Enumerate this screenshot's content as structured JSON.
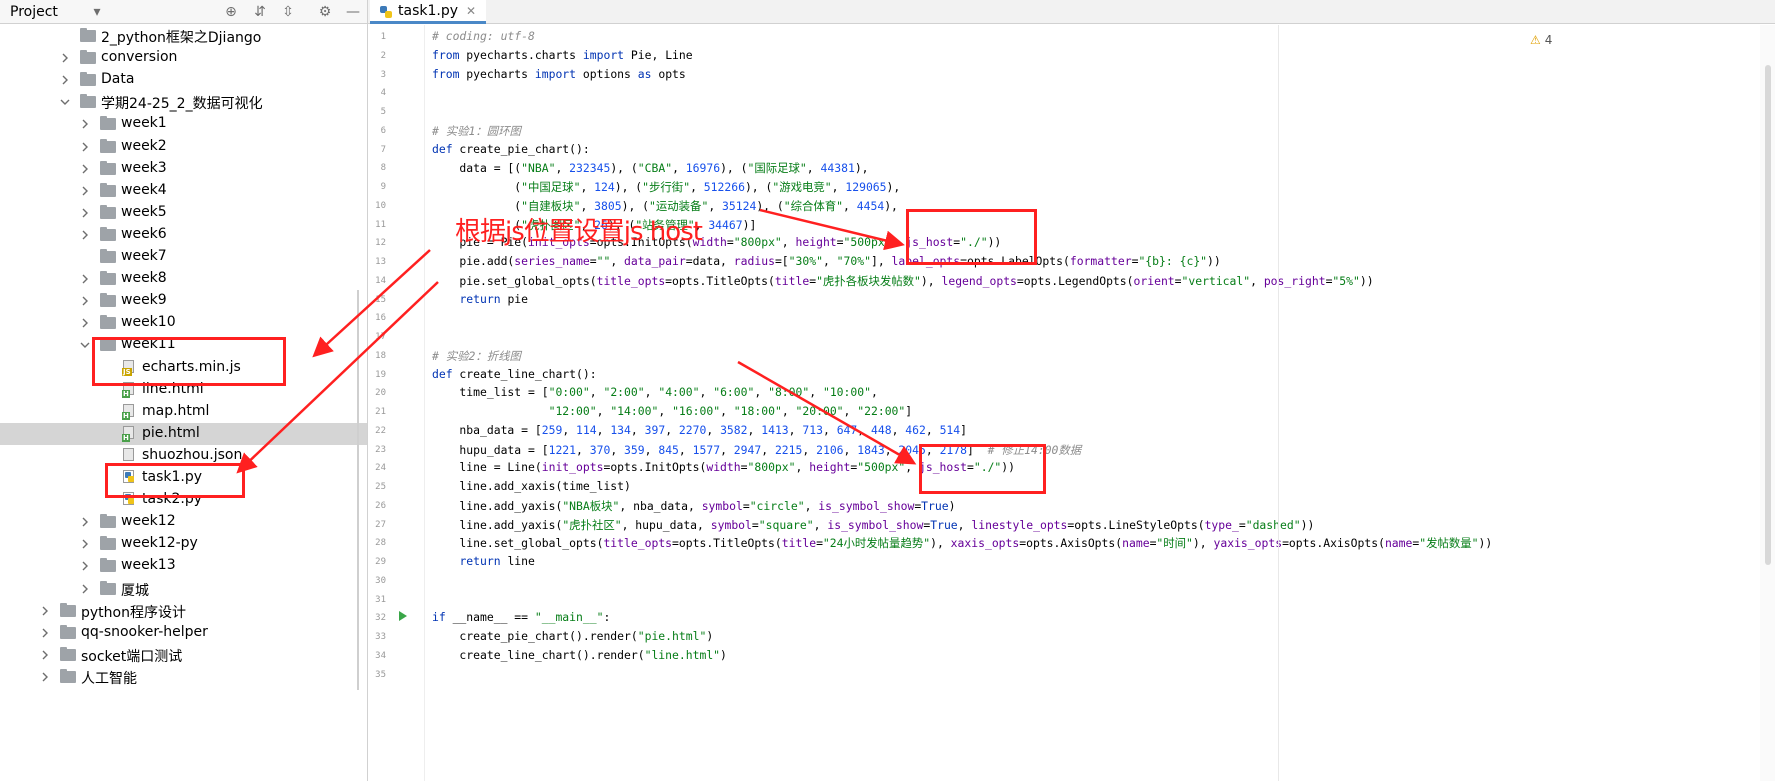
{
  "project_panel": {
    "title": "Project",
    "tree": [
      {
        "label": "2_python框架之Djiango",
        "indent": 1,
        "type": "folder",
        "expanded": null
      },
      {
        "label": "conversion",
        "indent": 1,
        "type": "folder",
        "expanded": false
      },
      {
        "label": "Data",
        "indent": 1,
        "type": "folder",
        "expanded": false
      },
      {
        "label": "学期24-25_2_数据可视化",
        "indent": 1,
        "type": "folder",
        "expanded": true
      },
      {
        "label": "week1",
        "indent": 2,
        "type": "folder",
        "expanded": false
      },
      {
        "label": "week2",
        "indent": 2,
        "type": "folder",
        "expanded": false
      },
      {
        "label": "week3",
        "indent": 2,
        "type": "folder",
        "expanded": false
      },
      {
        "label": "week4",
        "indent": 2,
        "type": "folder",
        "expanded": false
      },
      {
        "label": "week5",
        "indent": 2,
        "type": "folder",
        "expanded": false
      },
      {
        "label": "week6",
        "indent": 2,
        "type": "folder",
        "expanded": false
      },
      {
        "label": "week7",
        "indent": 2,
        "type": "folder",
        "expanded": null
      },
      {
        "label": "week8",
        "indent": 2,
        "type": "folder",
        "expanded": false
      },
      {
        "label": "week9",
        "indent": 2,
        "type": "folder",
        "expanded": false
      },
      {
        "label": "week10",
        "indent": 2,
        "type": "folder",
        "expanded": false
      },
      {
        "label": "week11",
        "indent": 2,
        "type": "folder",
        "expanded": true
      },
      {
        "label": "echarts.min.js",
        "indent": 3,
        "type": "js"
      },
      {
        "label": "line.html",
        "indent": 3,
        "type": "html"
      },
      {
        "label": "map.html",
        "indent": 3,
        "type": "html"
      },
      {
        "label": "pie.html",
        "indent": 3,
        "type": "html",
        "selected": true
      },
      {
        "label": "shuozhou.json",
        "indent": 3,
        "type": "json"
      },
      {
        "label": "task1.py",
        "indent": 3,
        "type": "py"
      },
      {
        "label": "task2.py",
        "indent": 3,
        "type": "py"
      },
      {
        "label": "week12",
        "indent": 2,
        "type": "folder",
        "expanded": false
      },
      {
        "label": "week12-py",
        "indent": 2,
        "type": "folder",
        "expanded": false
      },
      {
        "label": "week13",
        "indent": 2,
        "type": "folder",
        "expanded": false
      },
      {
        "label": "厦城",
        "indent": 2,
        "type": "folder",
        "expanded": false
      },
      {
        "label": "python程序设计",
        "indent": 0,
        "type": "folder",
        "expanded": false
      },
      {
        "label": "qq-snooker-helper",
        "indent": 0,
        "type": "folder",
        "expanded": false
      },
      {
        "label": "socket端口测试",
        "indent": 0,
        "type": "folder",
        "expanded": false
      },
      {
        "label": "人工智能",
        "indent": 0,
        "type": "folder",
        "expanded": false
      }
    ]
  },
  "editor": {
    "tab_label": "task1.py",
    "warning_count": "4",
    "lines": [
      "# coding: utf-8",
      "from pyecharts.charts import Pie, Line",
      "from pyecharts import options as opts",
      "",
      "",
      "# 实验1：圆环图",
      "def create_pie_chart():",
      "    data = [(\"NBA\", 232345), (\"CBA\", 16976), (\"国际足球\", 44381),",
      "            (\"中国足球\", 124), (\"步行街\", 512266), (\"游戏电竞\", 129065),",
      "            (\"自建板块\", 3805), (\"运动装备\", 35124), (\"综合体育\", 4454),",
      "            (\"虎扑图区\", 26), (\"站务管理\", 34467)]",
      "    pie = Pie(init_opts=opts.InitOpts(width=\"800px\", height=\"500px\", js_host=\"./\"))",
      "    pie.add(series_name=\"\", data_pair=data, radius=[\"30%\", \"70%\"], label_opts=opts.LabelOpts(formatter=\"{b}: {c}\"))",
      "    pie.set_global_opts(title_opts=opts.TitleOpts(title=\"虎扑各板块发帖数\"), legend_opts=opts.LegendOpts(orient=\"vertical\", pos_right=\"5%\"))",
      "    return pie",
      "",
      "",
      "# 实验2：折线图",
      "def create_line_chart():",
      "    time_list = [\"0:00\", \"2:00\", \"4:00\", \"6:00\", \"8:00\", \"10:00\",",
      "                 \"12:00\", \"14:00\", \"16:00\", \"18:00\", \"20:00\", \"22:00\"]",
      "    nba_data = [259, 114, 134, 397, 2270, 3582, 1413, 713, 647, 448, 462, 514]",
      "    hupu_data = [1221, 370, 359, 845, 1577, 2947, 2215, 2106, 1843, 2045, 2178]  # 修正14:00数据",
      "    line = Line(init_opts=opts.InitOpts(width=\"800px\", height=\"500px\", js_host=\"./\"))",
      "    line.add_xaxis(time_list)",
      "    line.add_yaxis(\"NBA板块\", nba_data, symbol=\"circle\", is_symbol_show=True)",
      "    line.add_yaxis(\"虎扑社区\", hupu_data, symbol=\"square\", is_symbol_show=True, linestyle_opts=opts.LineStyleOpts(type_=\"dashed\"))",
      "    line.set_global_opts(title_opts=opts.TitleOpts(title=\"24小时发帖量趋势\"), xaxis_opts=opts.AxisOpts(name=\"时间\"), yaxis_opts=opts.AxisOpts(name=\"发帖数量\"))",
      "    return line",
      "",
      "",
      "if __name__ == \"__main__\":",
      "    create_pie_chart().render(\"pie.html\")",
      "    create_line_chart().render(\"line.html\")",
      ""
    ]
  },
  "annotation": {
    "text": "根据js位置设置js host"
  },
  "colors": {
    "annotation_red": "#ff2020",
    "keyword": "#0033b3",
    "string": "#067d17",
    "number": "#1750eb",
    "comment": "#8c8c8c",
    "selection": "#d5d5d5"
  },
  "icons": {
    "gear": "gear-icon",
    "target": "locate-icon",
    "expand_all": "expand-all-icon",
    "collapse_all": "collapse-all-icon",
    "minimize": "minimize-icon",
    "dropdown": "chevron-down-icon",
    "run": "run-icon",
    "warning": "warning-icon"
  }
}
